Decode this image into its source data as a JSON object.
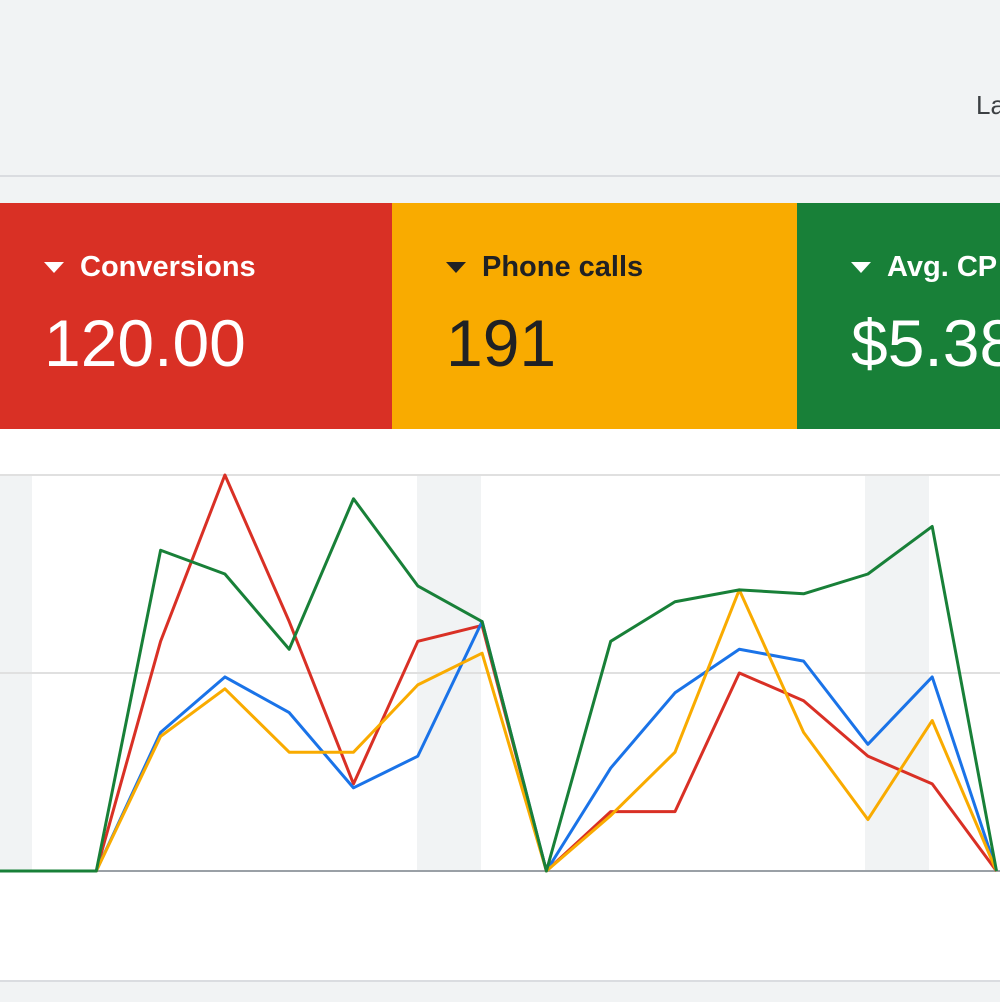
{
  "header": {
    "range_label_partial": "La"
  },
  "scorecards": [
    {
      "name": "Conversions",
      "value": "120.00",
      "bg": "#d93025",
      "fg": "#ffffff"
    },
    {
      "name": "Phone calls",
      "value": "191",
      "bg": "#f9ab00",
      "fg": "#202124"
    },
    {
      "name": "Avg. CP",
      "value": "$5.38",
      "bg": "#188038",
      "fg": "#ffffff"
    }
  ],
  "chart_data": {
    "type": "line",
    "x": [
      0,
      1,
      2,
      3,
      4,
      5,
      6,
      7,
      8,
      9,
      10,
      11,
      12,
      13,
      14,
      15
    ],
    "ylim": [
      0,
      100
    ],
    "grid": true,
    "series": [
      {
        "color": "#d93025",
        "values": [
          0,
          0,
          58,
          100,
          63,
          22,
          58,
          62,
          0,
          15,
          15,
          50,
          43,
          29,
          22,
          0
        ]
      },
      {
        "color": "#1a73e8",
        "values": [
          0,
          0,
          35,
          49,
          40,
          21,
          29,
          63,
          0,
          26,
          45,
          56,
          53,
          32,
          49,
          0
        ]
      },
      {
        "color": "#f9ab00",
        "values": [
          0,
          0,
          34,
          46,
          30,
          30,
          47,
          55,
          0,
          14,
          30,
          71,
          35,
          13,
          38,
          0
        ]
      },
      {
        "color": "#188038",
        "values": [
          0,
          0,
          81,
          75,
          56,
          94,
          72,
          63,
          0,
          58,
          68,
          71,
          70,
          75,
          87,
          0
        ]
      }
    ]
  }
}
